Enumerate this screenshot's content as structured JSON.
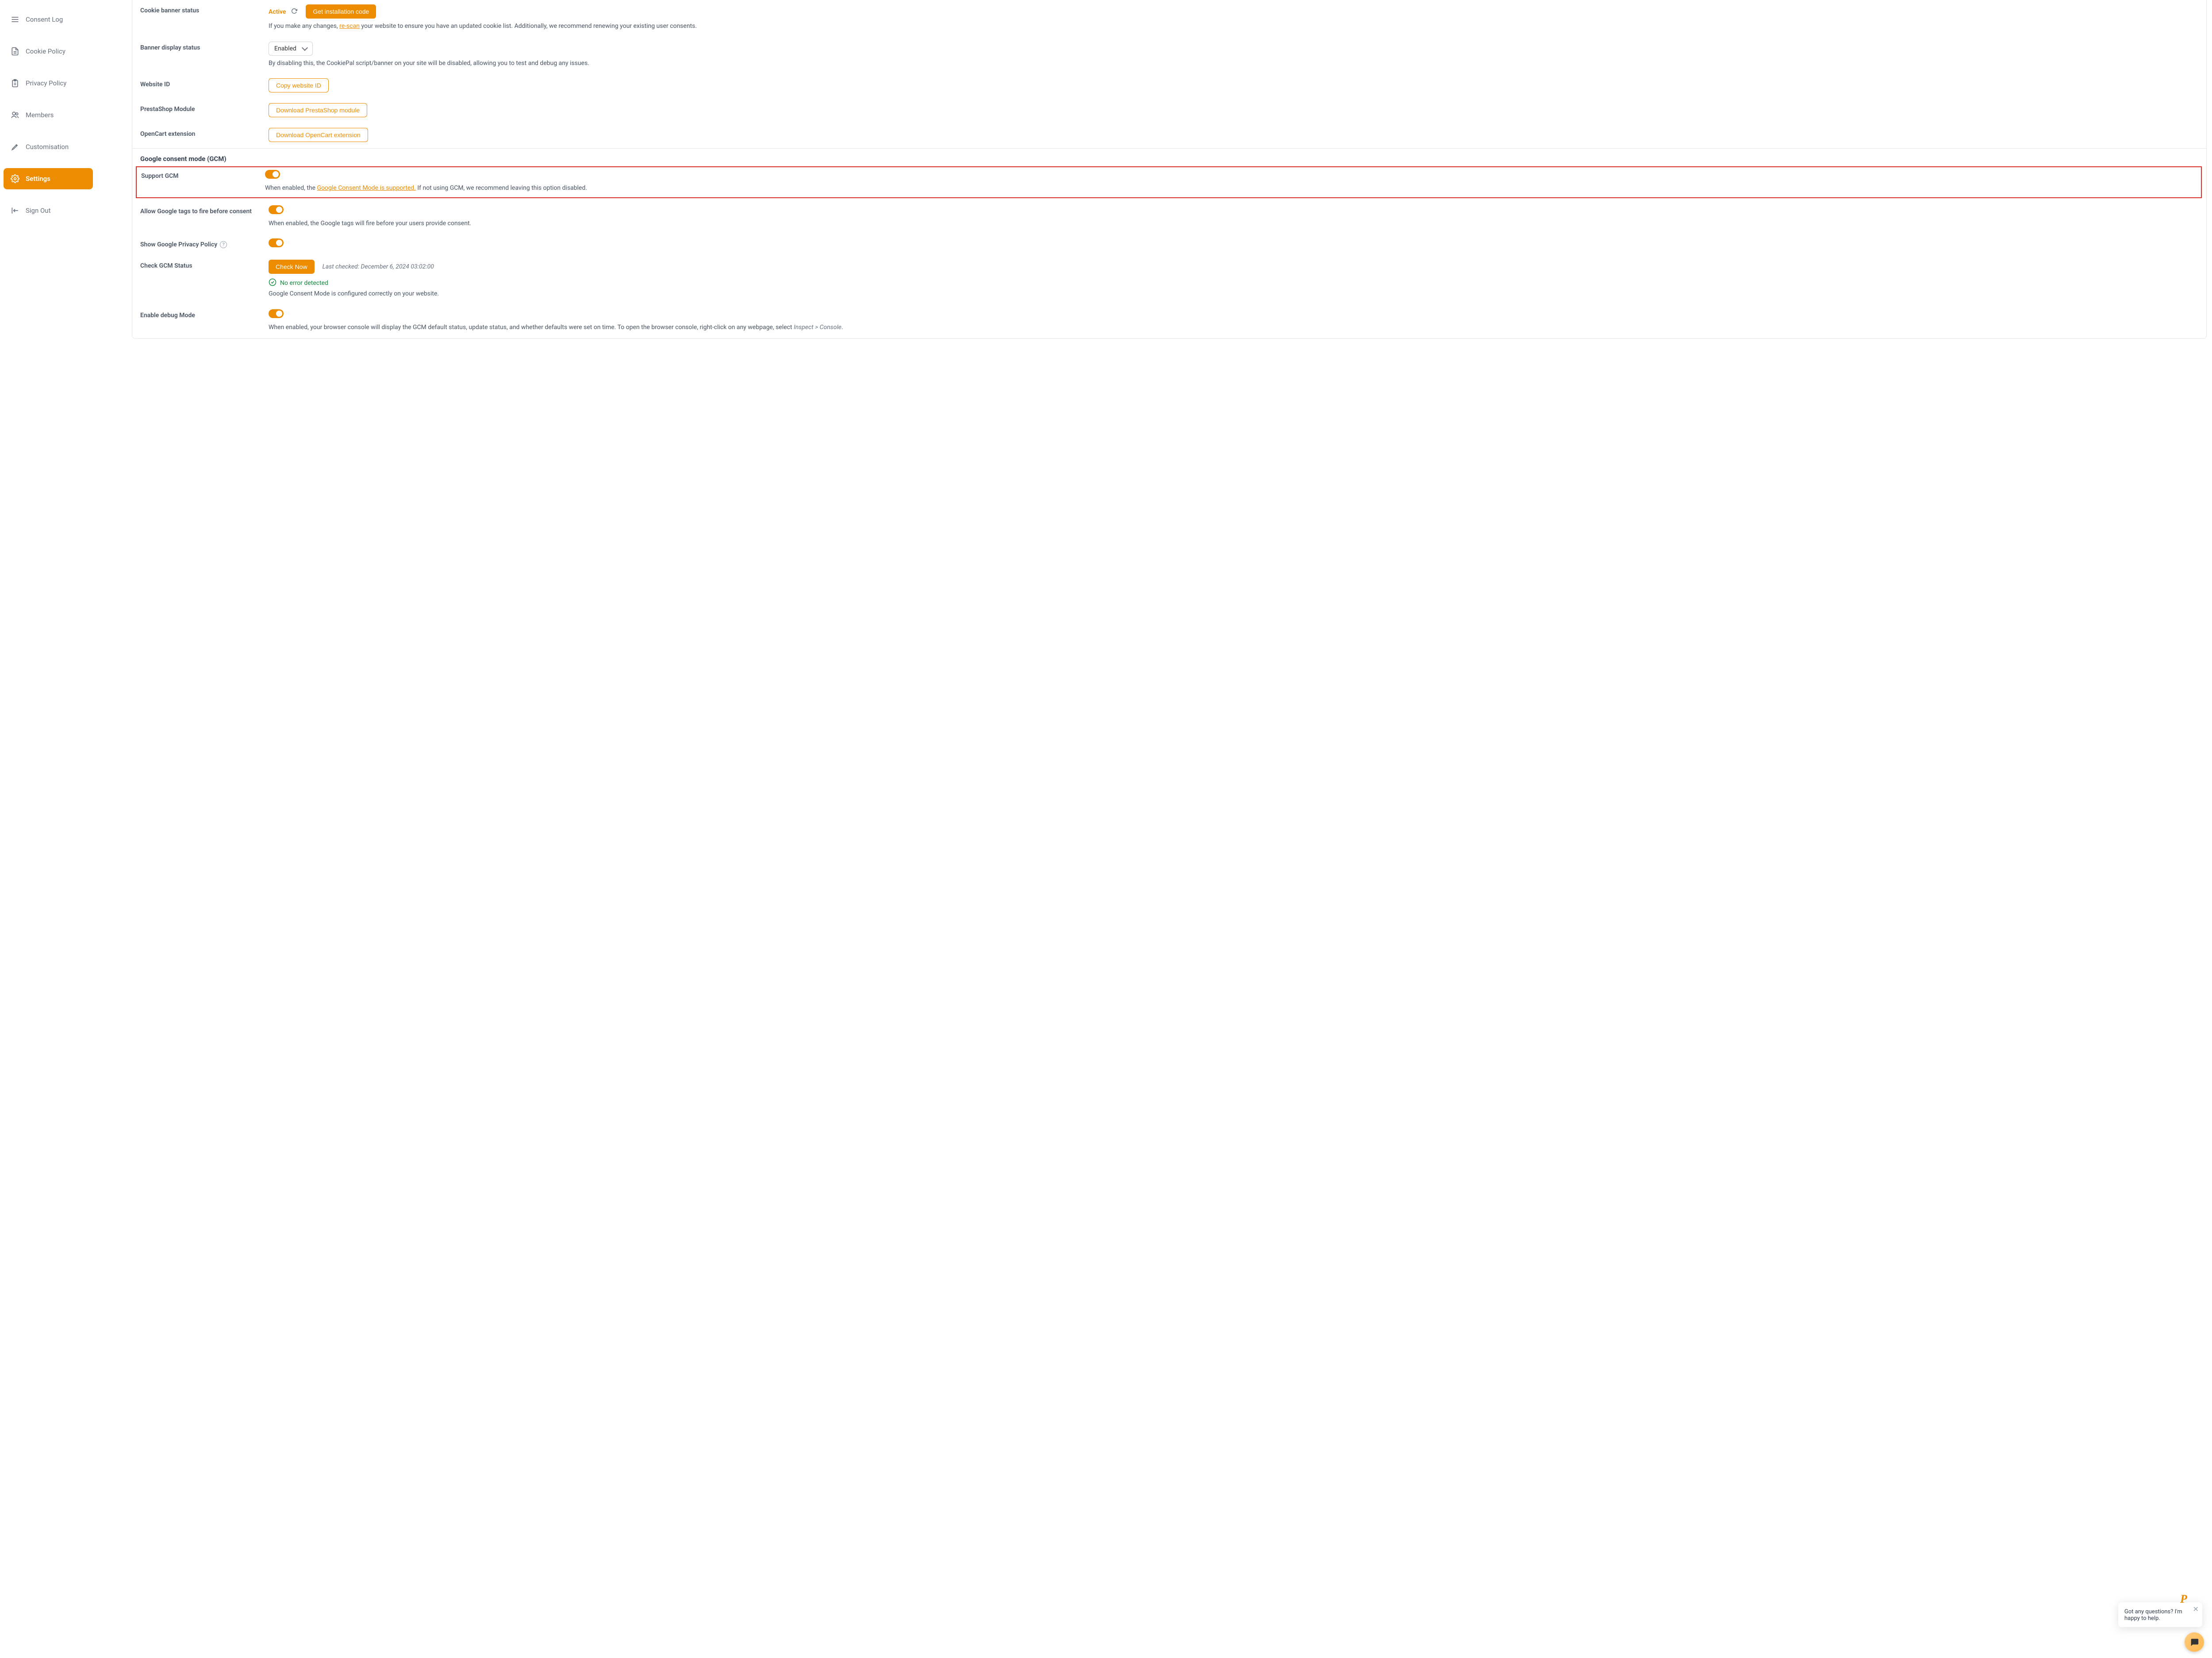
{
  "sidebar": {
    "items": [
      {
        "label": "Consent Log"
      },
      {
        "label": "Cookie Policy"
      },
      {
        "label": "Privacy Policy"
      },
      {
        "label": "Members"
      },
      {
        "label": "Customisation"
      },
      {
        "label": "Settings"
      },
      {
        "label": "Sign Out"
      }
    ]
  },
  "settings": {
    "cookieBanner": {
      "label": "Cookie banner status",
      "status": "Active",
      "installBtn": "Get installation code",
      "help1": "If you make any changes, ",
      "rescan": "re-scan",
      "help2": " your website to ensure you have an updated cookie list. Additionally, we recommend renewing your existing user consents."
    },
    "bannerDisplay": {
      "label": "Banner display status",
      "value": "Enabled",
      "help": "By disabling this, the CookiePal script/banner on your site will be disabled, allowing you to test and debug any issues."
    },
    "websiteId": {
      "label": "Website ID",
      "btn": "Copy website ID"
    },
    "presta": {
      "label": "PrestaShop Module",
      "btn": "Download PrestaShop module"
    },
    "opencart": {
      "label": "OpenCart extension",
      "btn": "Download OpenCart extension"
    },
    "gcm": {
      "header": "Google consent mode (GCM)",
      "support": {
        "label": "Support GCM",
        "help1": "When enabled, the ",
        "link": "Google Consent Mode is supported.",
        "help2": " If not using GCM, we recommend leaving this option disabled."
      },
      "allowFire": {
        "label": "Allow Google tags to fire before consent",
        "help": "When enabled, the Google tags will fire before your users provide consent."
      },
      "showPrivacy": {
        "label": "Show Google Privacy Policy"
      },
      "checkStatus": {
        "label": "Check GCM Status",
        "btn": "Check Now",
        "lastCheckedLabel": "Last checked: ",
        "lastCheckedValue": "December 6, 2024 03:02:00",
        "ok": "No error detected",
        "okHelp": "Google Consent Mode is configured correctly on your website."
      },
      "debug": {
        "label": "Enable debug Mode",
        "help1": "When enabled, your browser console will display the GCM default status, update status, and whether defaults were set on time. To open the browser console, right-click on any webpage, select ",
        "help2": "Inspect > Console",
        "help3": "."
      }
    }
  },
  "chat": {
    "text": "Got any questions? I'm happy to help."
  }
}
